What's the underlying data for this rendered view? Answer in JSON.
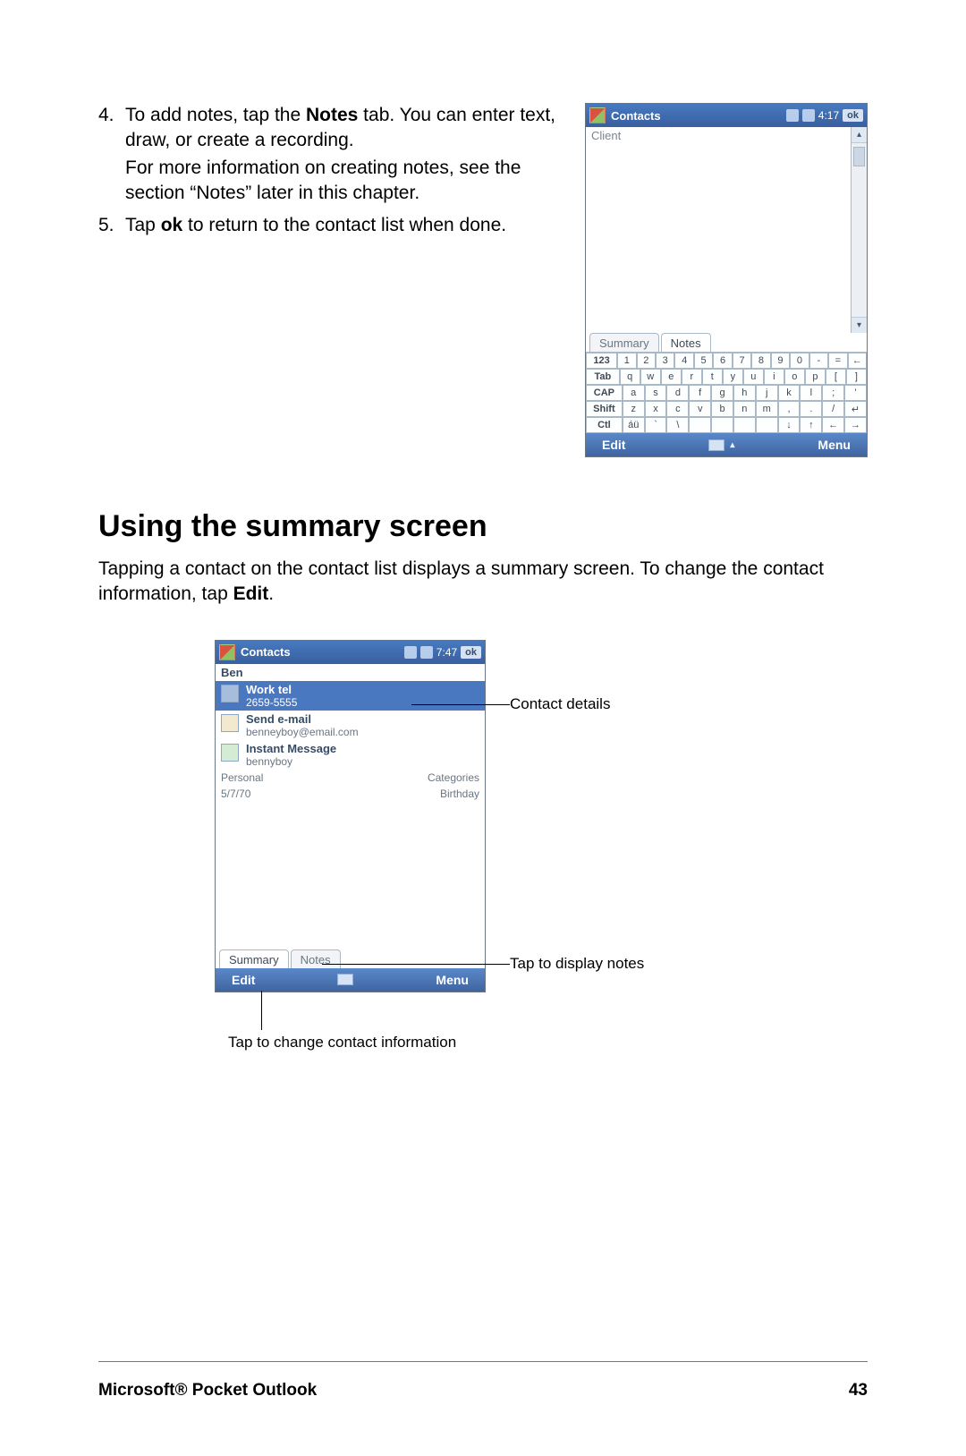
{
  "steps": {
    "s4": {
      "num": "4.",
      "p1a": "To add notes, tap the ",
      "p1b": "Notes",
      "p1c": " tab. You can enter text, draw, or create a recording.",
      "p2": "For more information on creating notes, see the section  “Notes” later in this chapter."
    },
    "s5": {
      "num": "5.",
      "p1a": "Tap ",
      "p1b": "ok",
      "p1c": " to return to the contact list when done."
    }
  },
  "ppc1": {
    "title": "Contacts",
    "time": "4:17",
    "ok": "ok",
    "bodyLabel": "Client",
    "tabSummary": "Summary",
    "tabNotes": "Notes",
    "edit": "Edit",
    "menu": "Menu",
    "kb": {
      "r1": [
        "123",
        "1",
        "2",
        "3",
        "4",
        "5",
        "6",
        "7",
        "8",
        "9",
        "0",
        "-",
        "=",
        "←"
      ],
      "r2": [
        "Tab",
        "q",
        "w",
        "e",
        "r",
        "t",
        "y",
        "u",
        "i",
        "o",
        "p",
        "[",
        "]"
      ],
      "r3": [
        "CAP",
        "a",
        "s",
        "d",
        "f",
        "g",
        "h",
        "j",
        "k",
        "l",
        ";",
        "'"
      ],
      "r4": [
        "Shift",
        "z",
        "x",
        "c",
        "v",
        "b",
        "n",
        "m",
        ",",
        ".",
        "/",
        "↵"
      ],
      "r5": [
        "Ctl",
        "áü",
        "`",
        "\\",
        "",
        "",
        "",
        "",
        "↓",
        "↑",
        "←",
        "→"
      ]
    }
  },
  "section": {
    "heading": "Using the summary screen",
    "p1a": "Tapping a contact on the contact list displays a summary screen. To change the contact information, tap ",
    "p1b": "Edit",
    "p1c": "."
  },
  "ppc2": {
    "title": "Contacts",
    "time": "7:47",
    "ok": "ok",
    "name": "Ben",
    "item1": {
      "label": "Work tel",
      "value": "2659-5555"
    },
    "item2": {
      "label": "Send e-mail",
      "value": "benneyboy@email.com"
    },
    "item3": {
      "label": "Instant Message",
      "value": "bennyboy"
    },
    "meta1": {
      "l": "Personal",
      "r": "Categories"
    },
    "meta2": {
      "l": "5/7/70",
      "r": "Birthday"
    },
    "tabSummary": "Summary",
    "tabNotes": "Notes",
    "edit": "Edit",
    "menu": "Menu"
  },
  "callouts": {
    "c1": "Contact details",
    "c2": "Tap to display notes",
    "c3": "Tap to change contact information"
  },
  "footer": {
    "chapter": "Microsoft® Pocket Outlook",
    "page": "43"
  }
}
